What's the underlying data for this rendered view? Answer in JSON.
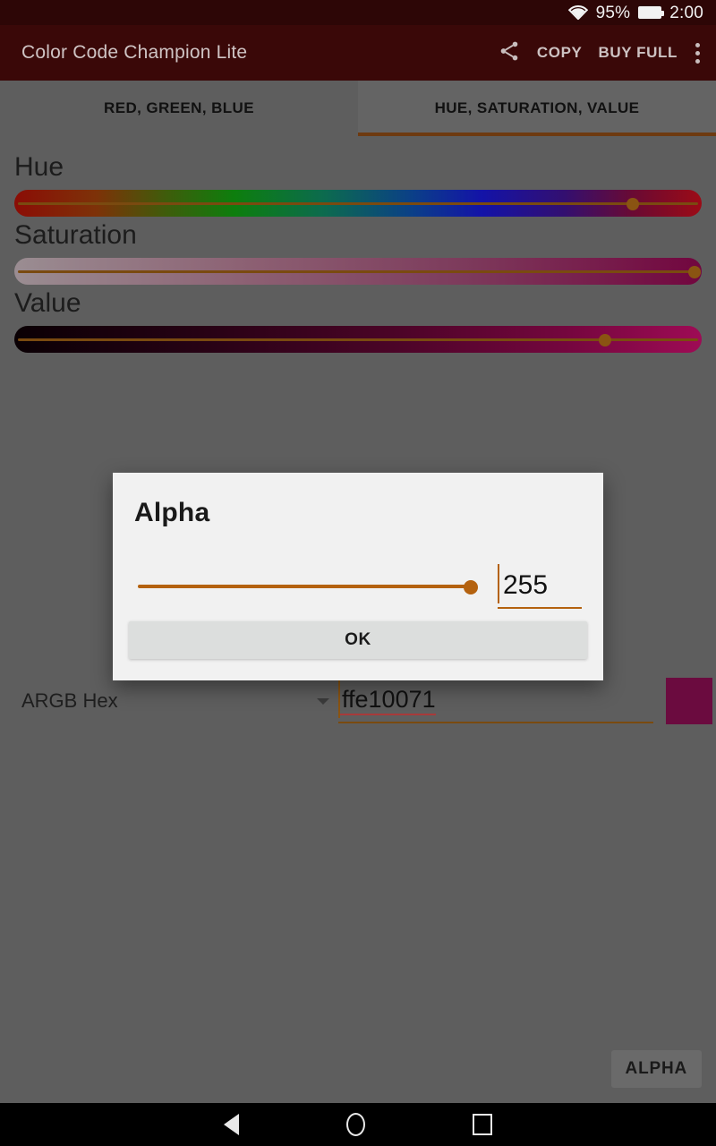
{
  "status_bar": {
    "wifi_icon": "wifi-icon",
    "battery_percent": "95%",
    "battery_icon": "battery-icon",
    "time": "2:00"
  },
  "app_bar": {
    "title": "Color Code Champion Lite",
    "share_icon": "share-icon",
    "copy_label": "COPY",
    "buy_full_label": "BUY FULL",
    "overflow_icon": "overflow-menu-icon"
  },
  "tabs": [
    {
      "label": "RED, GREEN, BLUE",
      "active": false
    },
    {
      "label": "HUE, SATURATION, VALUE",
      "active": true
    }
  ],
  "sliders": [
    {
      "label": "Hue",
      "value_percent": 90
    },
    {
      "label": "Saturation",
      "value_percent": 100
    },
    {
      "label": "Value",
      "value_percent": 86
    }
  ],
  "argb": {
    "label": "ARGB Hex",
    "dropdown_icon": "chevron-down-icon",
    "value": "ffe10071",
    "swatch_color": "#6b0b3f"
  },
  "alpha_button": {
    "label": "ALPHA"
  },
  "dialog": {
    "title": "Alpha",
    "slider_percent": 100,
    "input_value": "255",
    "ok_label": "OK"
  },
  "nav_bar": {
    "back_icon": "back-icon",
    "home_icon": "home-icon",
    "recents_icon": "recents-icon"
  },
  "colors": {
    "accent": "#b4620f",
    "app_bar": "#3a0808",
    "status_bar": "#2d0606",
    "scrim": "#5e5e5e"
  }
}
